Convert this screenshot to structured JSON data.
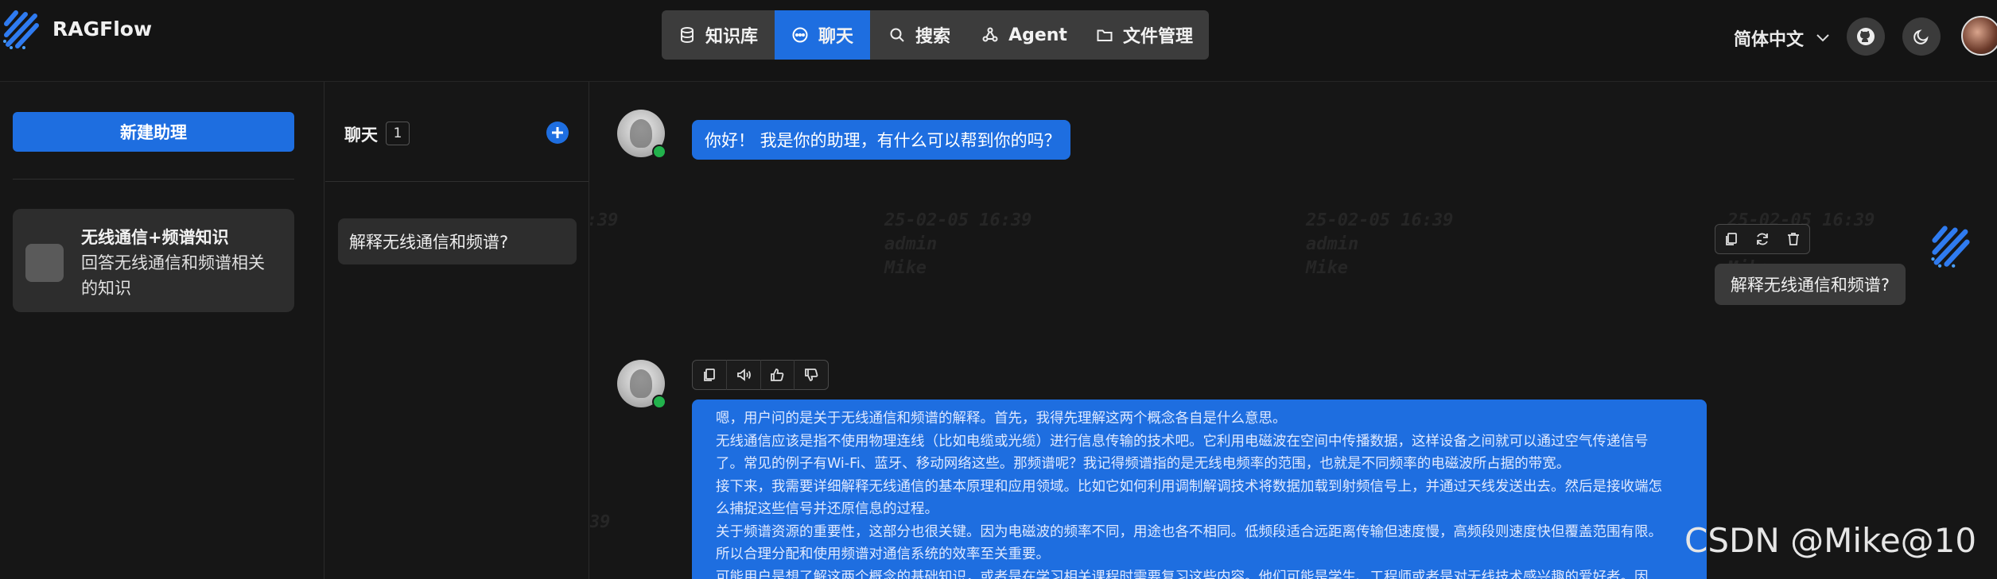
{
  "app": {
    "name": "RAGFlow"
  },
  "nav": {
    "items": [
      {
        "label": "知识库",
        "icon": "database-icon"
      },
      {
        "label": "聊天",
        "icon": "chat-icon"
      },
      {
        "label": "搜索",
        "icon": "search-icon"
      },
      {
        "label": "Agent",
        "icon": "agent-graph-icon"
      },
      {
        "label": "文件管理",
        "icon": "folder-icon"
      }
    ],
    "active": "聊天"
  },
  "header": {
    "language": "简体中文",
    "github_icon": "github-icon",
    "theme_icon": "moon-icon"
  },
  "sidebar": {
    "new_assistant_label": "新建助理",
    "assistant": {
      "name": "无线通信+频谱知识",
      "description": "回答无线通信和频谱相关的知识"
    }
  },
  "conversations": {
    "title": "聊天",
    "count": "1",
    "items": [
      {
        "label": "解释无线通信和频谱?"
      }
    ]
  },
  "chat": {
    "greeting": "你好！ 我是你的助理，有什么可以帮到你的吗？",
    "user_message": "解释无线通信和频谱?",
    "answer_lines": [
      "嗯，用户问的是关于无线通信和频谱的解释。首先，我得先理解这两个概念各自是什么意思。",
      "无线通信应该是指不使用物理连线（比如电缆或光缆）进行信息传输的技术吧。它利用电磁波在空间中传播数据，这样设备之间就可以通过空气传递信号",
      "了。常见的例子有Wi-Fi、蓝牙、移动网络这些。那频谱呢？我记得频谱指的是无线电频率的范围，也就是不同频率的电磁波所占据的带宽。",
      "接下来，我需要详细解释无线通信的基本原理和应用领域。比如它如何利用调制解调技术将数据加载到射频信号上，并通过天线发送出去。然后是接收端怎",
      "么捕捉这些信号并还原信息的过程。",
      "关于频谱资源的重要性，这部分也很关键。因为电磁波的频率不同，用途也各不相同。低频段适合远距离传输但速度慢，高频段则速度快但覆盖范围有限。",
      "所以合理分配和使用频谱对通信系统的效率至关重要。",
      "可能用户是想了解这两个概念的基础知识，或者是在学习相关课程时需要复习这些内容。他们可能是学生、工程师或者是对无线技术感兴趣的爱好者。因"
    ]
  },
  "watermark": {
    "line1": "25-02-05 16:39",
    "line2": "admin",
    "line3": "Mike"
  },
  "csdn_watermark": "CSDN @Mike@10",
  "colors": {
    "accent": "#1e6ee0",
    "background": "#161616",
    "online": "#22b24c"
  }
}
